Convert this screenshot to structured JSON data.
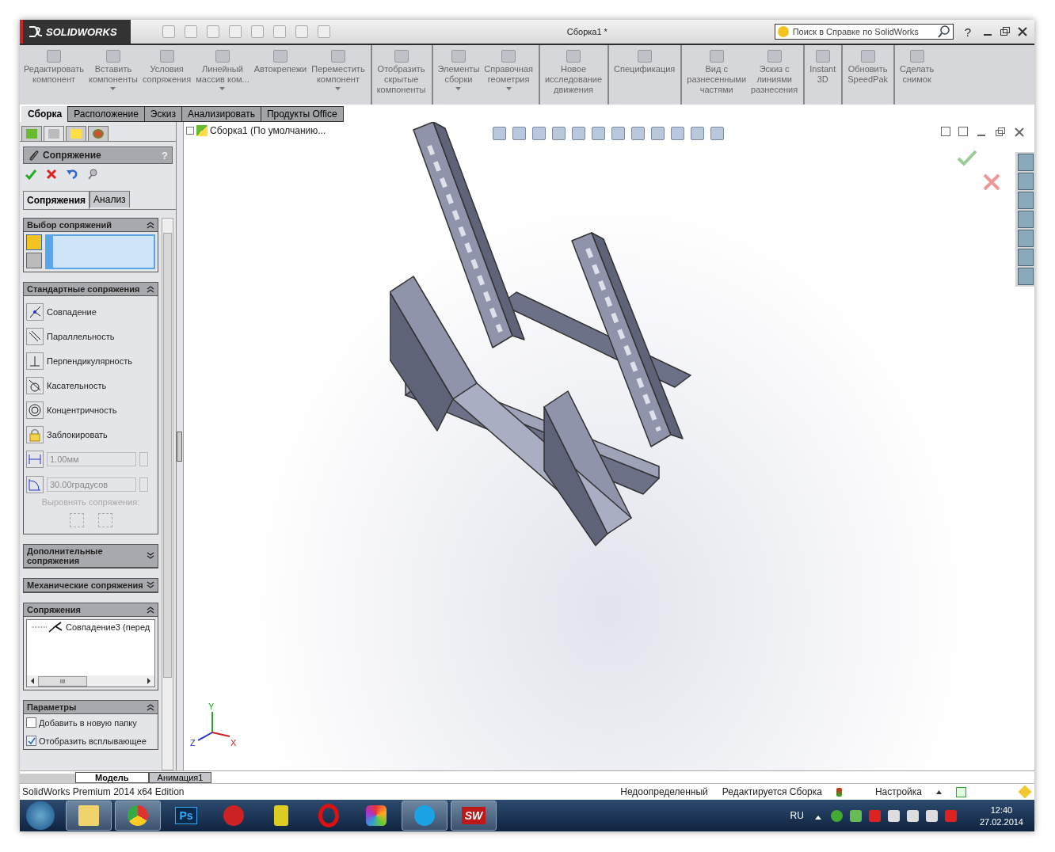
{
  "titlebar": {
    "logo": "SOLIDWORKS",
    "document": "Сборка1 *",
    "search": {
      "placeholder": "Поиск в Справке по SolidWorks"
    },
    "help": "?"
  },
  "ribbon": [
    {
      "label": "Редактировать\nкомпонент",
      "dropdown": false,
      "divider_before": false
    },
    {
      "label": "Вставить\nкомпоненты",
      "dropdown": true,
      "divider_before": false
    },
    {
      "label": "Условия\nсопряжения",
      "dropdown": false,
      "divider_before": false
    },
    {
      "label": "Линейный\nмассив ком...",
      "dropdown": true,
      "divider_before": false
    },
    {
      "label": "Автокрепежи",
      "dropdown": false,
      "divider_before": false
    },
    {
      "label": "Переместить\nкомпонент",
      "dropdown": true,
      "divider_before": false
    },
    {
      "label": "Отобразить\nскрытые\nкомпоненты",
      "dropdown": false,
      "divider_before": true
    },
    {
      "label": "Элементы\nсборки",
      "dropdown": true,
      "divider_before": true
    },
    {
      "label": "Справочная\nгеометрия",
      "dropdown": true,
      "divider_before": false
    },
    {
      "label": "Новое\nисследование\nдвижения",
      "dropdown": false,
      "divider_before": true
    },
    {
      "label": "Спецификация",
      "dropdown": false,
      "divider_before": true
    },
    {
      "label": "Вид с\nразнесенными\nчастями",
      "dropdown": false,
      "divider_before": true
    },
    {
      "label": "Эскиз с\nлиниями\nразнесения",
      "dropdown": false,
      "divider_before": false
    },
    {
      "label": "Instant\n3D",
      "dropdown": false,
      "divider_before": true
    },
    {
      "label": "Обновить\nSpeedPak",
      "dropdown": false,
      "divider_before": true
    },
    {
      "label": "Сделать\nснимок",
      "dropdown": false,
      "divider_before": true
    }
  ],
  "command_tabs": [
    {
      "label": "Сборка",
      "selected": true
    },
    {
      "label": "Расположение",
      "selected": false
    },
    {
      "label": "Эскиз",
      "selected": false
    },
    {
      "label": "Анализировать",
      "selected": false
    },
    {
      "label": "Продукты Office",
      "selected": false
    }
  ],
  "manager_tabs": [
    {
      "selected": false
    },
    {
      "selected": true
    },
    {
      "selected": false
    },
    {
      "selected": false
    }
  ],
  "property_manager": {
    "title": "Сопряжение",
    "help": "?",
    "tabs": [
      {
        "label": "Сопряжения",
        "selected": true
      },
      {
        "label": "Анализ",
        "selected": false
      }
    ],
    "sections": [
      {
        "kind": "selection",
        "title": "Выбор сопряжений",
        "expanded": true
      },
      {
        "kind": "standard",
        "title": "Стандартные сопряжения",
        "expanded": true,
        "mates": [
          {
            "kind": "coincident",
            "label": "Совпадение"
          },
          {
            "kind": "parallel",
            "label": "Параллельность"
          },
          {
            "kind": "perpendicular",
            "label": "Перпендикулярность"
          },
          {
            "kind": "tangent",
            "label": "Касательность"
          },
          {
            "kind": "concentric",
            "label": "Концентричность"
          },
          {
            "kind": "lock",
            "label": "Заблокировать"
          }
        ],
        "distance": "1.00мм",
        "angle": "30.00градусов",
        "align_label": "Выровнять сопряжения:"
      },
      {
        "title": "Дополнительные\nсопряжения",
        "expanded": false
      },
      {
        "title": "Механические сопряжения",
        "expanded": false
      },
      {
        "kind": "list",
        "title": "Сопряжения",
        "expanded": true,
        "items": [
          "Совпадение3 (перед"
        ],
        "scroll_label": "III"
      },
      {
        "kind": "options",
        "title": "Параметры",
        "expanded": true,
        "options": [
          {
            "label": "Добавить в новую папку",
            "checked": false
          },
          {
            "label": "Отобразить всплывающее",
            "checked": true
          }
        ]
      }
    ]
  },
  "tree": {
    "root": "Сборка1  (По умолчанию..."
  },
  "triad": {
    "y": "Y",
    "x": "X",
    "z": "Z"
  },
  "bottom_tabs": [
    {
      "label": "Модель",
      "selected": true
    },
    {
      "label": "Анимация1",
      "selected": false
    }
  ],
  "status_bar": {
    "edition": "SolidWorks Premium 2014 x64 Edition",
    "state": "Недоопределенный",
    "mode": "Редактируется Сборка",
    "settings": "Настройка"
  },
  "taskbar": {
    "apps": [
      {
        "kind": "explorer",
        "running": true
      },
      {
        "kind": "chrome",
        "running": true
      },
      {
        "kind": "photoshop",
        "label": "Ps",
        "running": false
      },
      {
        "kind": "flame",
        "running": false
      },
      {
        "kind": "robot",
        "running": false
      },
      {
        "kind": "opera",
        "running": false
      },
      {
        "kind": "pinwheel",
        "running": false
      },
      {
        "kind": "skype",
        "running": true
      },
      {
        "kind": "solidworks",
        "label": "SW",
        "running": true
      }
    ],
    "language": "RU",
    "time": "12:40",
    "date": "27.02.2014"
  }
}
